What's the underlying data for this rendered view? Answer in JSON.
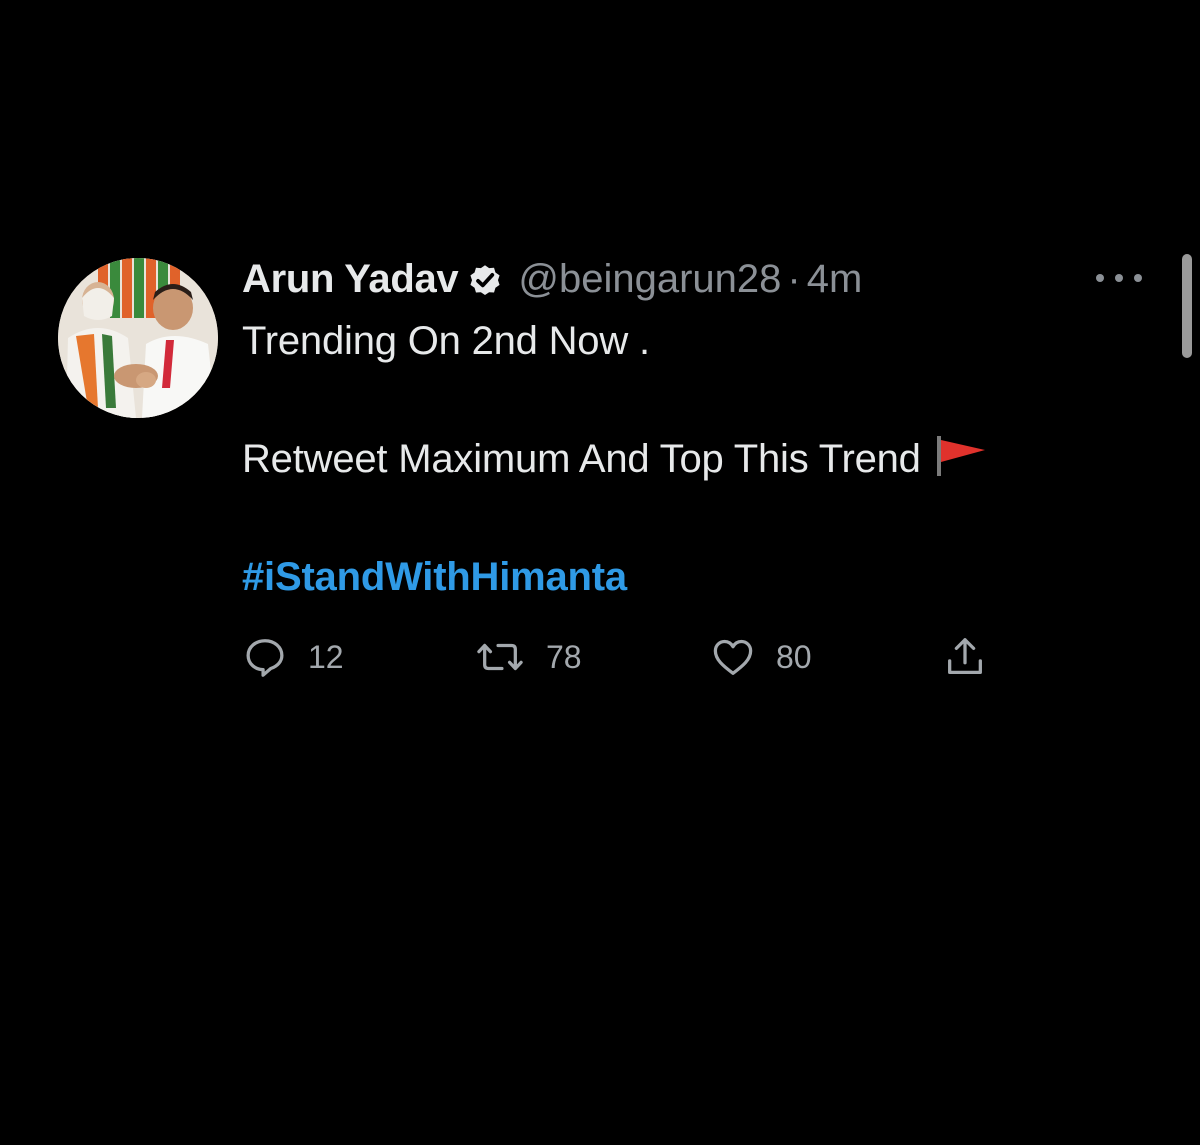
{
  "tweet": {
    "display_name": "Arun Yadav",
    "handle": "@beingarun28",
    "separator": "·",
    "timestamp": "4m",
    "text_line_1": "Trending On 2nd Now .",
    "text_line_2": "Retweet Maximum And Top This Trend",
    "hashtag": "#iStandWithHimanta",
    "flag_emoji": "red-triangular-flag-icon",
    "verified_icon": "verified-badge-icon"
  },
  "actions": {
    "reply_count": "12",
    "retweet_count": "78",
    "like_count": "80"
  },
  "colors": {
    "background": "#000000",
    "primary_text": "#e7e9ea",
    "secondary_text": "#8b9096",
    "hashtag": "#2f9ae6",
    "flag": "#e0322c"
  }
}
